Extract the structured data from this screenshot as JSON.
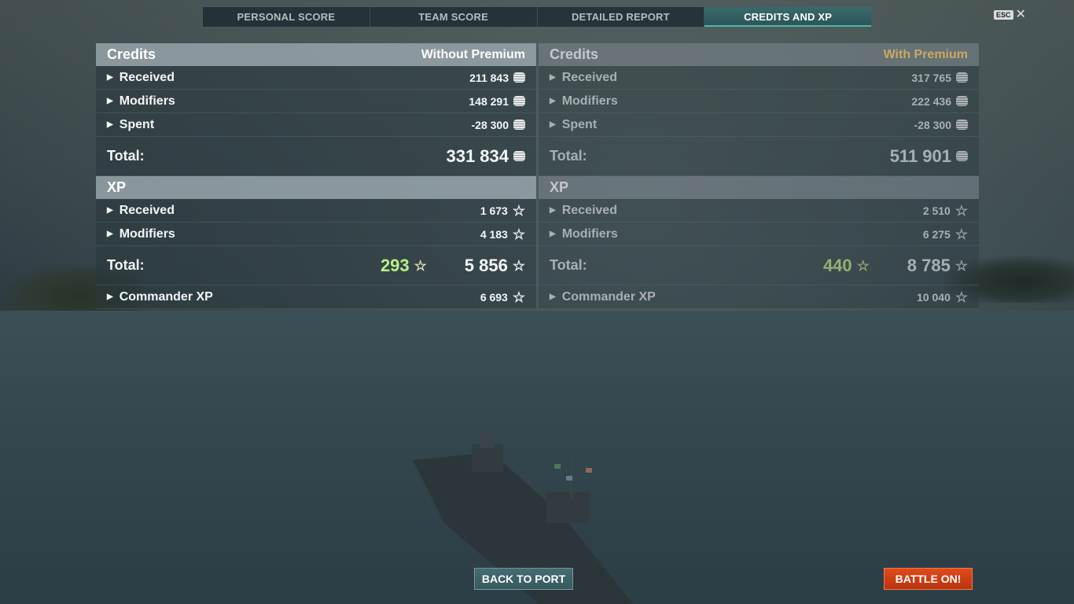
{
  "tabs": [
    {
      "label": "PERSONAL SCORE",
      "active": false
    },
    {
      "label": "TEAM SCORE",
      "active": false
    },
    {
      "label": "DETAILED REPORT",
      "active": false
    },
    {
      "label": "CREDITS AND XP",
      "active": true
    }
  ],
  "esc": {
    "key_label": "ESC",
    "close_glyph": "✕"
  },
  "without_premium": {
    "credits_title": "Credits",
    "column_label": "Without Premium",
    "credits_rows": [
      {
        "label": "Received",
        "value": "211 843"
      },
      {
        "label": "Modifiers",
        "value": "148 291"
      },
      {
        "label": "Spent",
        "value": "-28 300"
      }
    ],
    "credits_total_label": "Total:",
    "credits_total": "331 834",
    "xp_title": "XP",
    "xp_rows": [
      {
        "label": "Received",
        "value": "1 673"
      },
      {
        "label": "Modifiers",
        "value": "4 183"
      }
    ],
    "xp_total_label": "Total:",
    "xp_bonus": "293",
    "xp_total": "5 856",
    "commander_label": "Commander XP",
    "commander_value": "6 693"
  },
  "with_premium": {
    "credits_title": "Credits",
    "column_label": "With Premium",
    "credits_rows": [
      {
        "label": "Received",
        "value": "317 765"
      },
      {
        "label": "Modifiers",
        "value": "222 436"
      },
      {
        "label": "Spent",
        "value": "-28 300"
      }
    ],
    "credits_total_label": "Total:",
    "credits_total": "511 901",
    "xp_title": "XP",
    "xp_rows": [
      {
        "label": "Received",
        "value": "2 510"
      },
      {
        "label": "Modifiers",
        "value": "6 275"
      }
    ],
    "xp_total_label": "Total:",
    "xp_bonus": "440",
    "xp_total": "8 785",
    "commander_label": "Commander XP",
    "commander_value": "10 040"
  },
  "buttons": {
    "back_to_port": "BACK TO PORT",
    "battle_on": "BATTLE ON!"
  },
  "icons": {
    "credits": "credits-coin-icon",
    "xp": "star-icon",
    "expand": "caret-right-icon"
  },
  "colors": {
    "accent_tab": "#2a5356",
    "premium_gold": "#c9a960",
    "bonus_green": "#b7f08a",
    "battle_button": "#d8401a"
  }
}
